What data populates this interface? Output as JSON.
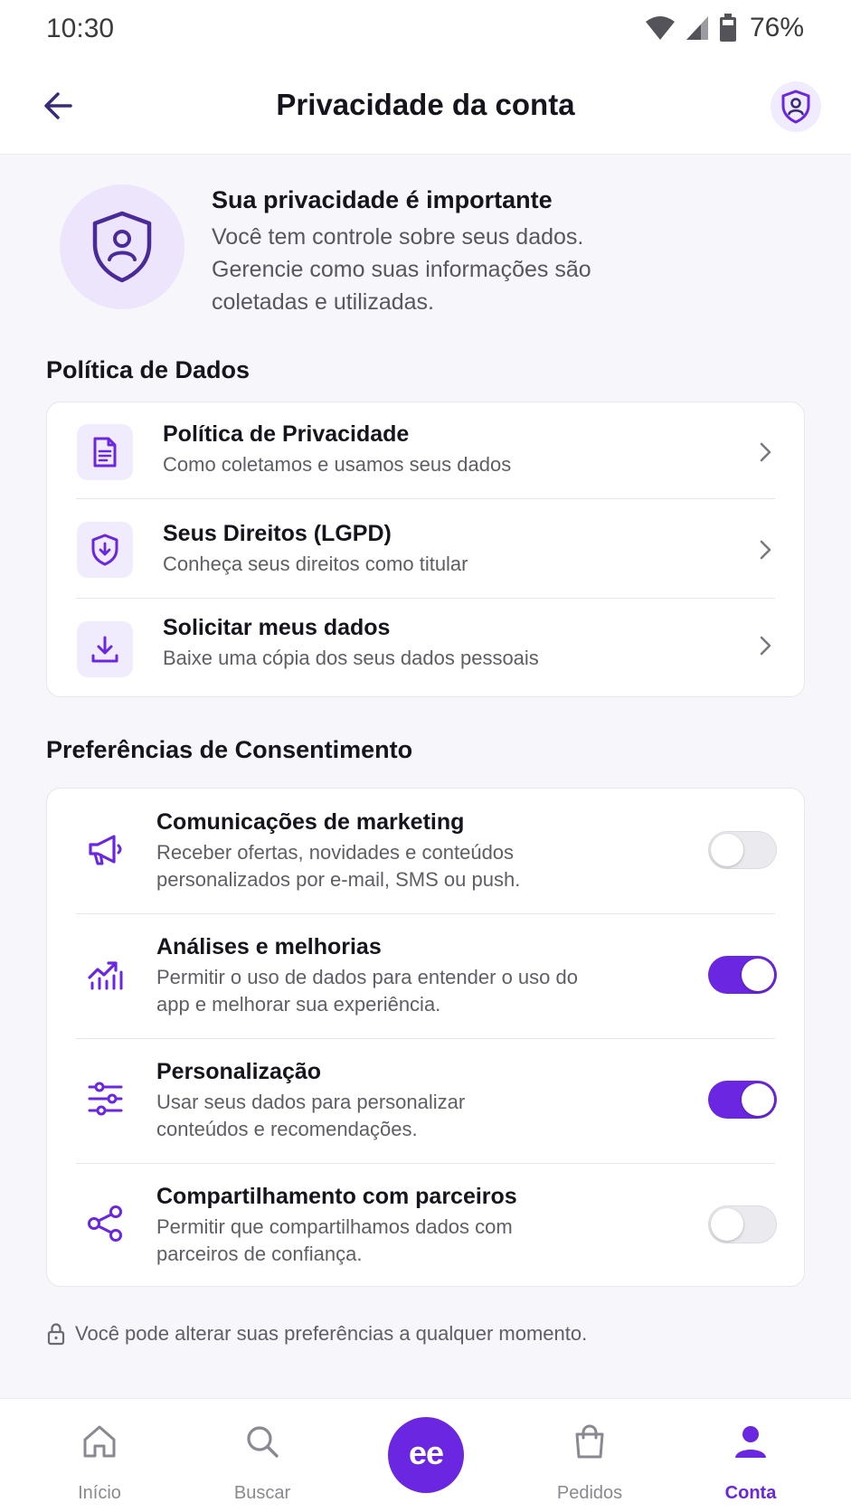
{
  "status_bar": {
    "time": "10:30",
    "battery": "76%"
  },
  "header": {
    "title": "Privacidade da conta"
  },
  "intro": {
    "title": "Sua privacidade é importante",
    "line1": "Você tem controle sobre seus dados.",
    "line2": "Gerencie como suas informações são",
    "line3": "coletadas e utilizadas."
  },
  "policy_section": {
    "heading": "Política de Dados",
    "items": [
      {
        "title": "Política de Privacidade",
        "subtitle": "Como coletamos e usamos seus dados",
        "icon": "document-icon"
      },
      {
        "title": "Seus Direitos (LGPD)",
        "subtitle": "Conheça seus direitos como titular",
        "icon": "shield-check-icon"
      },
      {
        "title": "Solicitar meus dados",
        "subtitle": "Baixe uma cópia dos seus dados pessoais",
        "icon": "download-icon"
      }
    ]
  },
  "consent_section": {
    "heading": "Preferências de Consentimento",
    "items": [
      {
        "title": "Comunicações de marketing",
        "line1": "Receber ofertas, novidades e conteúdos",
        "line2": "personalizados por e-mail, SMS ou push.",
        "enabled": false,
        "icon": "megaphone-icon"
      },
      {
        "title": "Análises e melhorias",
        "line1": "Permitir o uso de dados para entender o uso do",
        "line2": "app e melhorar sua experiência.",
        "enabled": true,
        "icon": "analytics-icon"
      },
      {
        "title": "Personalização",
        "line1": "Usar seus dados para personalizar",
        "line2": "conteúdos e recomendações.",
        "enabled": true,
        "icon": "sliders-icon"
      },
      {
        "title": "Compartilhamento com parceiros",
        "line1": "Permitir que compartilhamos dados com",
        "line2": "parceiros de confiança.",
        "enabled": false,
        "icon": "share-icon"
      }
    ]
  },
  "footer_note": "Você pode alterar suas preferências a qualquer momento.",
  "bottom_nav": {
    "items": [
      {
        "label": "Início",
        "icon": "home-icon"
      },
      {
        "label": "Buscar",
        "icon": "search-icon"
      },
      {
        "label": "Pedidos",
        "icon": "bag-icon"
      },
      {
        "label": "Conta",
        "icon": "user-icon",
        "active": true
      }
    ],
    "center_logo": "ee"
  },
  "colors": {
    "accent": "#6a26e0",
    "accent_light": "#f1ecfd",
    "text": "#16141c",
    "muted": "#5f5d66"
  }
}
